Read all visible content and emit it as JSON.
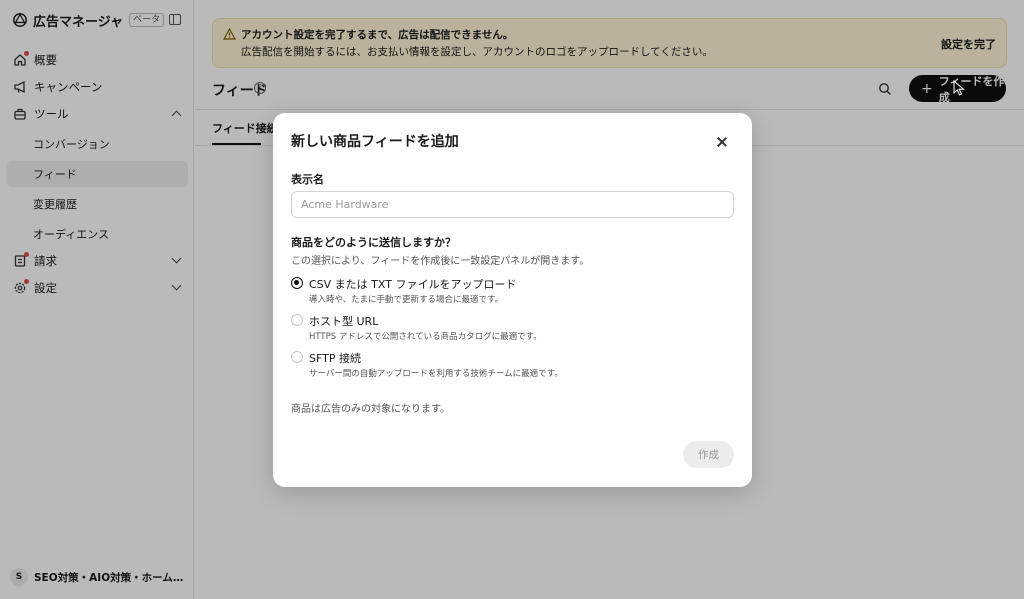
{
  "app": {
    "title": "広告マネージャ",
    "beta": "ベータ"
  },
  "sidebar": {
    "items": [
      {
        "label": "概要"
      },
      {
        "label": "キャンペーン"
      },
      {
        "label": "ツール"
      },
      {
        "label": "請求"
      },
      {
        "label": "設定"
      }
    ],
    "tools_sub": [
      {
        "label": "コンバージョン"
      },
      {
        "label": "フィード"
      },
      {
        "label": "変更履歴"
      },
      {
        "label": "オーディエンス"
      }
    ],
    "account": {
      "initial": "S",
      "name": "SEO対策・AIO対策・ホームページ..."
    }
  },
  "banner": {
    "title": "アカウント設定を完了するまで、広告は配信できません。",
    "body": "広告配信を開始するには、お支払い情報を設定し、アカウントのロゴをアップロードしてください。",
    "action": "設定を完了"
  },
  "page": {
    "title": "フィード",
    "help": "?",
    "create_label": "フィードを作成",
    "tab": "フィード接続"
  },
  "modal": {
    "title": "新しい商品フィードを追加",
    "name_label": "表示名",
    "name_placeholder": "Acme Hardware",
    "question": "商品をどのように送信しますか？",
    "question_help": "この選択により、フィードを作成後に一致設定パネルが開きます。",
    "options": [
      {
        "label": "CSV または TXT ファイルをアップロード",
        "desc": "導入時や、たまに手動で更新する場合に最適です。",
        "selected": true
      },
      {
        "label": "ホスト型 URL",
        "desc": "HTTPS アドレスで公開されている商品カタログに最適です。",
        "selected": false
      },
      {
        "label": "SFTP 接続",
        "desc": "サーバー間の自動アップロードを利用する技術チームに最適です。",
        "selected": false
      }
    ],
    "note": "商品は広告のみの対象になります。",
    "submit": "作成"
  },
  "colors": {
    "banner_bg": "#fff4d6",
    "accent": "#0f0f0f",
    "notify_dot": "#e5484d"
  }
}
